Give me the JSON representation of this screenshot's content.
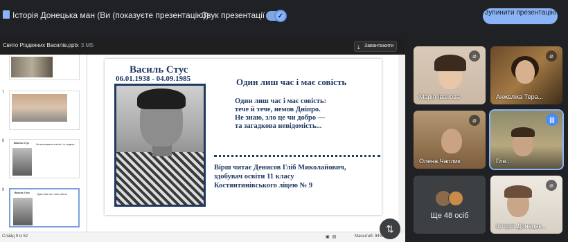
{
  "topbar": {
    "presentation_title": "Історія Донецька ман (Ви (показуєте презентацію))",
    "sound_label": "Звук презентації",
    "sound_enabled": true,
    "stop_button": "Зупинити презентацію"
  },
  "ppt": {
    "file_name": "Свято Різдвяних Василів.pptx",
    "file_size": "3 МБ",
    "download_label": "Завантажити",
    "thumbnails": [
      {
        "number": "7"
      },
      {
        "number": "8",
        "title": "Василь Стус",
        "subtitle": "На вшанування пам'яті та подвигу"
      },
      {
        "number": "9",
        "title": "Василь Стус",
        "subtitle": "Один лиш час і має совість"
      }
    ],
    "status_counter": "Слайд 9 із 52",
    "zoom": "Масштаб: 94%"
  },
  "slide": {
    "name": "Василь Стус",
    "dates": "06.01.1938 - 04.09.1985",
    "heading": "Один лиш час і має совість",
    "poem": [
      "Один лиш час і має совість:",
      "тече й тече, немов Дніпро.",
      "Не знаю, зло це чи добро —",
      "та загадкова невідомість..."
    ],
    "reader": [
      "Вірш читає Денисов Гліб Миколайович,",
      "здобувач освіти 11 класу",
      "Костянтинівського ліцею № 9"
    ]
  },
  "participants": [
    {
      "name": "Марія Іванова",
      "mic": "off"
    },
    {
      "name": "Анжеліка Тера...",
      "mic": "off"
    },
    {
      "name": "Олена Чаплик",
      "mic": "off"
    },
    {
      "name": "Гле...",
      "mic": "speaking"
    },
    {
      "name": "Ще 48 осіб",
      "mic": "none"
    },
    {
      "name": "Історія Донецьк...",
      "mic": "off"
    }
  ],
  "colors": {
    "accent": "#8ab4f8",
    "slide_text": "#1f3864",
    "background": "#202124"
  },
  "icons": {
    "mic_off": "mic-off-icon",
    "speaking": "audio-wave-icon",
    "toggle_check": "check-icon",
    "download": "download-icon",
    "fab": "swap-icon"
  }
}
